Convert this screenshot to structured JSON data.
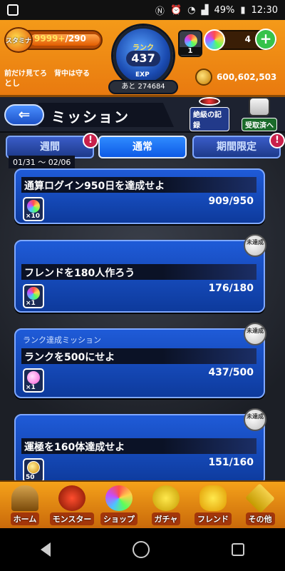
{
  "status_bar": {
    "battery": "49%",
    "time": "12:30"
  },
  "hud": {
    "stamina_icon_label": "スタミナ",
    "stamina_current": "9999+",
    "stamina_max": "/290",
    "stamina_fill": 1.0,
    "player_comment": "前だけ見てろ　背中は守る",
    "player_name": "とし",
    "rank_label": "ランク",
    "rank_value": "437",
    "exp_label": "EXP",
    "exp_remaining": "あと 274684",
    "orb_box_count": "1",
    "gem_count": "4",
    "gold": "600,602,503"
  },
  "page": {
    "title": "ミッション",
    "btn_record": "絶級の記録",
    "btn_received": "受取済へ"
  },
  "tabs": {
    "week": "週間",
    "normal": "通常",
    "limited": "期間限定",
    "week_badge": "!",
    "limited_badge": "!",
    "date_range": "01/31 ～ 02/06"
  },
  "missions": [
    {
      "name": "通算ログイン950日を達成せよ",
      "progress": "909/950",
      "reward_qty": "×10",
      "status": ""
    },
    {
      "name": "フレンドを180人作ろう",
      "progress": "176/180",
      "reward_qty": "×1",
      "status": "未達成"
    },
    {
      "category": "ランク達成ミッション",
      "name": "ランクを500にせよ",
      "progress": "437/500",
      "reward_qty": "×1",
      "status": "未達成"
    },
    {
      "name": "運極を160体達成せよ",
      "progress": "151/160",
      "reward_qty": "50",
      "status": "未達成"
    }
  ],
  "bottom_nav": {
    "home": "ホーム",
    "monster": "モンスター",
    "shop": "ショップ",
    "gacha": "ガチャ",
    "friend": "フレンド",
    "other": "その他"
  },
  "colors": {
    "hud_orange": "#f49a19",
    "card_blue": "#1f5bd8",
    "tab_active": "#0d5ae6",
    "plus_green": "#36c24a"
  }
}
